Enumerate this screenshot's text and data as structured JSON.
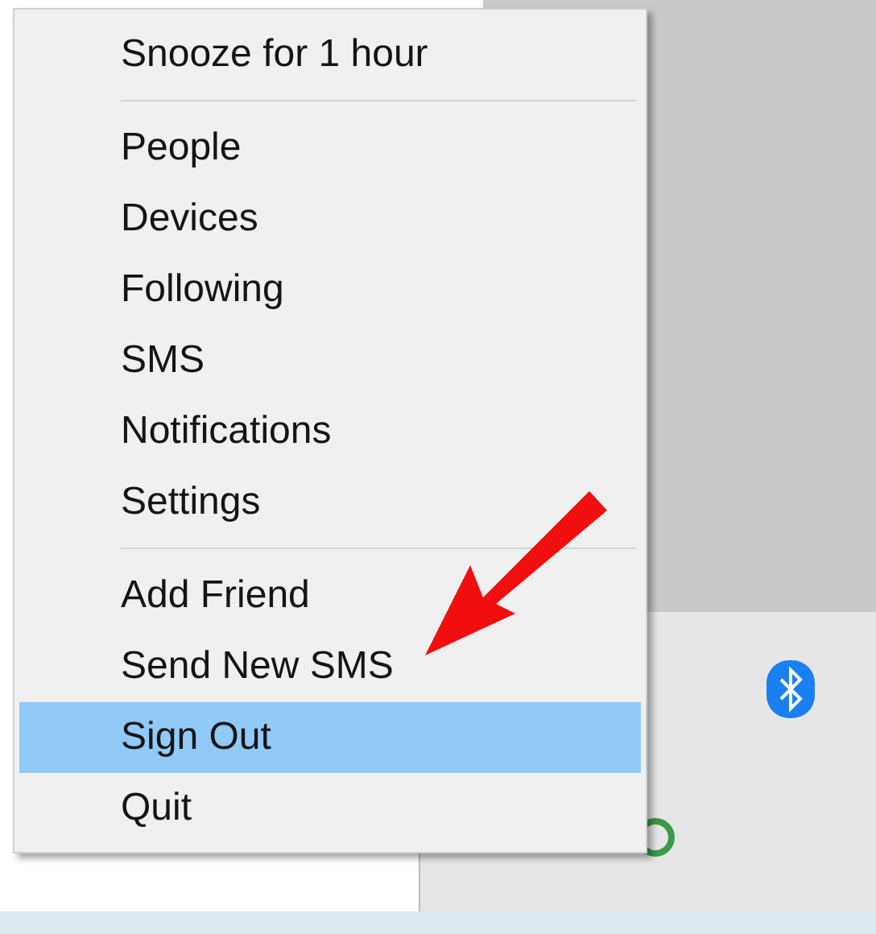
{
  "menu": {
    "sections": [
      {
        "items": [
          {
            "label": "Snooze for 1 hour",
            "selected": false
          }
        ]
      },
      {
        "items": [
          {
            "label": "People",
            "selected": false
          },
          {
            "label": "Devices",
            "selected": false
          },
          {
            "label": "Following",
            "selected": false
          },
          {
            "label": "SMS",
            "selected": false
          },
          {
            "label": "Notifications",
            "selected": false
          },
          {
            "label": "Settings",
            "selected": false
          }
        ]
      },
      {
        "items": [
          {
            "label": "Add Friend",
            "selected": false
          },
          {
            "label": "Send New SMS",
            "selected": false
          },
          {
            "label": "Sign Out",
            "selected": true
          },
          {
            "label": "Quit",
            "selected": false
          }
        ]
      }
    ]
  }
}
